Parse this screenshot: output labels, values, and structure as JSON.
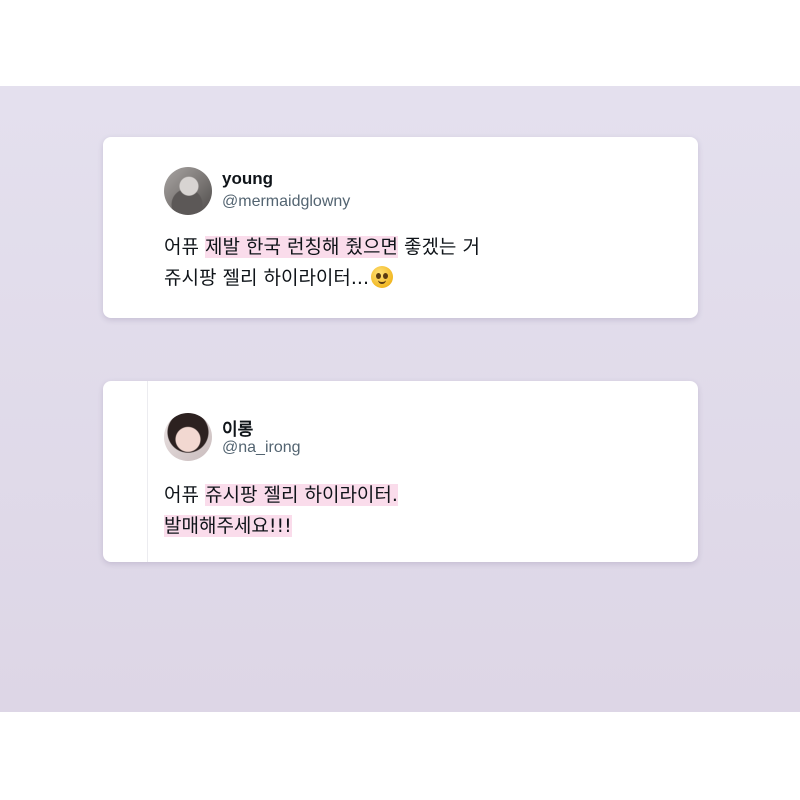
{
  "cards": [
    {
      "display_name": "young",
      "handle": "@mermaidglowny",
      "avatar_icon": "profile-photo",
      "text_segments": [
        {
          "text": "어퓨 ",
          "highlight": false
        },
        {
          "text": "제발 한국 런칭해 줬으면",
          "highlight": true
        },
        {
          "text": " 좋겠는 거",
          "highlight": false
        },
        {
          "text": "쥬시팡 젤리 하이라이터...",
          "highlight": false
        }
      ],
      "emoji": "pleading-face"
    },
    {
      "display_name": "이롱",
      "handle": "@na_irong",
      "avatar_icon": "profile-photo",
      "text_segments": [
        {
          "text": "어퓨 ",
          "highlight": false
        },
        {
          "text": "쥬시팡 젤리 하이라이터.",
          "highlight": true
        },
        {
          "text": "발매해주세요!!!",
          "highlight": true
        }
      ]
    }
  ],
  "colors": {
    "highlight": "#fadceb",
    "name_text": "#0f1419",
    "handle_text": "#536471",
    "panel_top": "#e4e0ee",
    "panel_bottom": "#ddd6e6"
  }
}
